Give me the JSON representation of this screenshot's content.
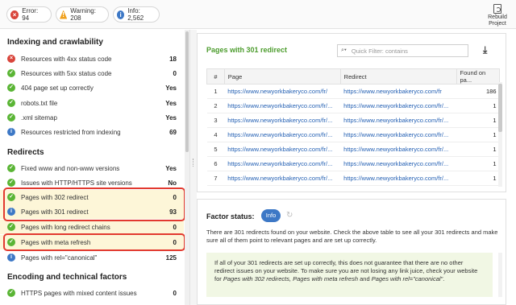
{
  "topbar": {
    "error": {
      "label": "Error: 94",
      "color": "#d9453b"
    },
    "warning": {
      "label": "Warning: 208",
      "color": "#f0a11e"
    },
    "info": {
      "label": "Info: 2,562",
      "color": "#3d78c6"
    },
    "rebuild": {
      "line1": "Rebuild",
      "line2": "Project"
    }
  },
  "left": {
    "sections": [
      {
        "title": "Indexing and crawlability"
      },
      {
        "title": "Redirects"
      },
      {
        "title": "Encoding and technical factors"
      }
    ],
    "items": [
      {
        "status": "error",
        "label": "Resources with 4xx status code",
        "value": "18"
      },
      {
        "status": "ok",
        "label": "Resources with 5xx status code",
        "value": "0"
      },
      {
        "status": "ok",
        "label": "404 page set up correctly",
        "value": "Yes"
      },
      {
        "status": "ok",
        "label": "robots.txt file",
        "value": "Yes"
      },
      {
        "status": "ok",
        "label": ".xml sitemap",
        "value": "Yes"
      },
      {
        "status": "info",
        "label": "Resources restricted from indexing",
        "value": "69"
      },
      {
        "status": "ok",
        "label": "Fixed www and non-www versions",
        "value": "Yes"
      },
      {
        "status": "ok",
        "label": "Issues with HTTP/HTTPS site versions",
        "value": "No"
      },
      {
        "status": "ok",
        "label": "Pages with 302 redirect",
        "value": "0"
      },
      {
        "status": "info",
        "label": "Pages with 301 redirect",
        "value": "93"
      },
      {
        "status": "ok",
        "label": "Pages with long redirect chains",
        "value": "0"
      },
      {
        "status": "ok",
        "label": "Pages with meta refresh",
        "value": "0"
      },
      {
        "status": "info",
        "label": "Pages with rel=\"canonical\"",
        "value": "125"
      },
      {
        "status": "ok",
        "label": "HTTPS pages with mixed content issues",
        "value": "0"
      }
    ]
  },
  "table_card": {
    "title": "Pages with 301 redirect",
    "filter_placeholder": "Quick Filter: contains",
    "columns": [
      "#",
      "Page",
      "Redirect",
      "Found on pa..."
    ],
    "rows": [
      {
        "num": "1",
        "page": "https://www.newyorkbakeryco.com/fr/",
        "redirect": "https://www.newyorkbakeryco.com/fr",
        "found": "186"
      },
      {
        "num": "2",
        "page": "https://www.newyorkbakeryco.com/fr/...",
        "redirect": "https://www.newyorkbakeryco.com/fr/...",
        "found": "1"
      },
      {
        "num": "3",
        "page": "https://www.newyorkbakeryco.com/fr/...",
        "redirect": "https://www.newyorkbakeryco.com/fr/...",
        "found": "1"
      },
      {
        "num": "4",
        "page": "https://www.newyorkbakeryco.com/fr/...",
        "redirect": "https://www.newyorkbakeryco.com/fr/...",
        "found": "1"
      },
      {
        "num": "5",
        "page": "https://www.newyorkbakeryco.com/fr/...",
        "redirect": "https://www.newyorkbakeryco.com/fr/...",
        "found": "1"
      },
      {
        "num": "6",
        "page": "https://www.newyorkbakeryco.com/fr/...",
        "redirect": "https://www.newyorkbakeryco.com/fr/...",
        "found": "1"
      },
      {
        "num": "7",
        "page": "https://www.newyorkbakeryco.com/fr/...",
        "redirect": "https://www.newyorkbakeryco.com/fr/...",
        "found": "1"
      }
    ]
  },
  "factor": {
    "title": "Factor status:",
    "badge": "Info",
    "description": "There are 301 redirects found on your website. Check the above table to see all your 301 redirects and make sure all of them point to relevant pages and are set up correctly.",
    "note_a": "If all of your 301 redirects are set up correctly, this does not guarantee that there are no other redirect issues on your website. To make sure you are not losing any link juice, check your website for ",
    "note_b": "Pages with 302 redirects, Pages with meta refresh",
    "note_c": " and ",
    "note_d": "Pages with rel=\"canonical\"",
    "note_e": "."
  }
}
